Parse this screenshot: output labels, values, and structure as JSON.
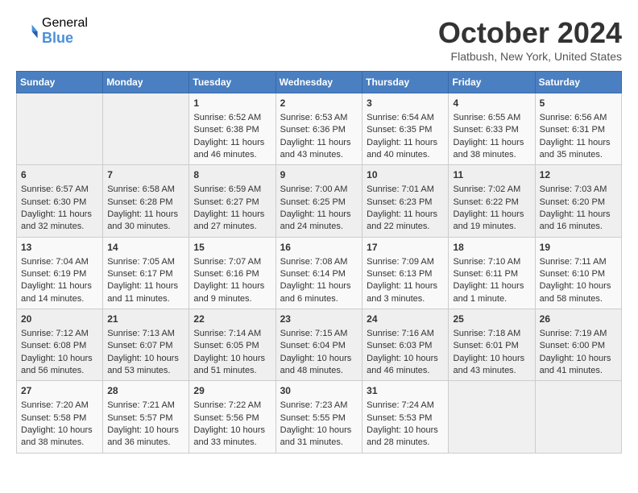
{
  "header": {
    "logo_general": "General",
    "logo_blue": "Blue",
    "month": "October 2024",
    "location": "Flatbush, New York, United States"
  },
  "weekdays": [
    "Sunday",
    "Monday",
    "Tuesday",
    "Wednesday",
    "Thursday",
    "Friday",
    "Saturday"
  ],
  "weeks": [
    [
      {
        "day": "",
        "empty": true
      },
      {
        "day": "",
        "empty": true
      },
      {
        "day": "1",
        "sunrise": "6:52 AM",
        "sunset": "6:38 PM",
        "daylight": "11 hours and 46 minutes."
      },
      {
        "day": "2",
        "sunrise": "6:53 AM",
        "sunset": "6:36 PM",
        "daylight": "11 hours and 43 minutes."
      },
      {
        "day": "3",
        "sunrise": "6:54 AM",
        "sunset": "6:35 PM",
        "daylight": "11 hours and 40 minutes."
      },
      {
        "day": "4",
        "sunrise": "6:55 AM",
        "sunset": "6:33 PM",
        "daylight": "11 hours and 38 minutes."
      },
      {
        "day": "5",
        "sunrise": "6:56 AM",
        "sunset": "6:31 PM",
        "daylight": "11 hours and 35 minutes."
      }
    ],
    [
      {
        "day": "6",
        "sunrise": "6:57 AM",
        "sunset": "6:30 PM",
        "daylight": "11 hours and 32 minutes."
      },
      {
        "day": "7",
        "sunrise": "6:58 AM",
        "sunset": "6:28 PM",
        "daylight": "11 hours and 30 minutes."
      },
      {
        "day": "8",
        "sunrise": "6:59 AM",
        "sunset": "6:27 PM",
        "daylight": "11 hours and 27 minutes."
      },
      {
        "day": "9",
        "sunrise": "7:00 AM",
        "sunset": "6:25 PM",
        "daylight": "11 hours and 24 minutes."
      },
      {
        "day": "10",
        "sunrise": "7:01 AM",
        "sunset": "6:23 PM",
        "daylight": "11 hours and 22 minutes."
      },
      {
        "day": "11",
        "sunrise": "7:02 AM",
        "sunset": "6:22 PM",
        "daylight": "11 hours and 19 minutes."
      },
      {
        "day": "12",
        "sunrise": "7:03 AM",
        "sunset": "6:20 PM",
        "daylight": "11 hours and 16 minutes."
      }
    ],
    [
      {
        "day": "13",
        "sunrise": "7:04 AM",
        "sunset": "6:19 PM",
        "daylight": "11 hours and 14 minutes."
      },
      {
        "day": "14",
        "sunrise": "7:05 AM",
        "sunset": "6:17 PM",
        "daylight": "11 hours and 11 minutes."
      },
      {
        "day": "15",
        "sunrise": "7:07 AM",
        "sunset": "6:16 PM",
        "daylight": "11 hours and 9 minutes."
      },
      {
        "day": "16",
        "sunrise": "7:08 AM",
        "sunset": "6:14 PM",
        "daylight": "11 hours and 6 minutes."
      },
      {
        "day": "17",
        "sunrise": "7:09 AM",
        "sunset": "6:13 PM",
        "daylight": "11 hours and 3 minutes."
      },
      {
        "day": "18",
        "sunrise": "7:10 AM",
        "sunset": "6:11 PM",
        "daylight": "11 hours and 1 minute."
      },
      {
        "day": "19",
        "sunrise": "7:11 AM",
        "sunset": "6:10 PM",
        "daylight": "10 hours and 58 minutes."
      }
    ],
    [
      {
        "day": "20",
        "sunrise": "7:12 AM",
        "sunset": "6:08 PM",
        "daylight": "10 hours and 56 minutes."
      },
      {
        "day": "21",
        "sunrise": "7:13 AM",
        "sunset": "6:07 PM",
        "daylight": "10 hours and 53 minutes."
      },
      {
        "day": "22",
        "sunrise": "7:14 AM",
        "sunset": "6:05 PM",
        "daylight": "10 hours and 51 minutes."
      },
      {
        "day": "23",
        "sunrise": "7:15 AM",
        "sunset": "6:04 PM",
        "daylight": "10 hours and 48 minutes."
      },
      {
        "day": "24",
        "sunrise": "7:16 AM",
        "sunset": "6:03 PM",
        "daylight": "10 hours and 46 minutes."
      },
      {
        "day": "25",
        "sunrise": "7:18 AM",
        "sunset": "6:01 PM",
        "daylight": "10 hours and 43 minutes."
      },
      {
        "day": "26",
        "sunrise": "7:19 AM",
        "sunset": "6:00 PM",
        "daylight": "10 hours and 41 minutes."
      }
    ],
    [
      {
        "day": "27",
        "sunrise": "7:20 AM",
        "sunset": "5:58 PM",
        "daylight": "10 hours and 38 minutes."
      },
      {
        "day": "28",
        "sunrise": "7:21 AM",
        "sunset": "5:57 PM",
        "daylight": "10 hours and 36 minutes."
      },
      {
        "day": "29",
        "sunrise": "7:22 AM",
        "sunset": "5:56 PM",
        "daylight": "10 hours and 33 minutes."
      },
      {
        "day": "30",
        "sunrise": "7:23 AM",
        "sunset": "5:55 PM",
        "daylight": "10 hours and 31 minutes."
      },
      {
        "day": "31",
        "sunrise": "7:24 AM",
        "sunset": "5:53 PM",
        "daylight": "10 hours and 28 minutes."
      },
      {
        "day": "",
        "empty": true
      },
      {
        "day": "",
        "empty": true
      }
    ]
  ]
}
